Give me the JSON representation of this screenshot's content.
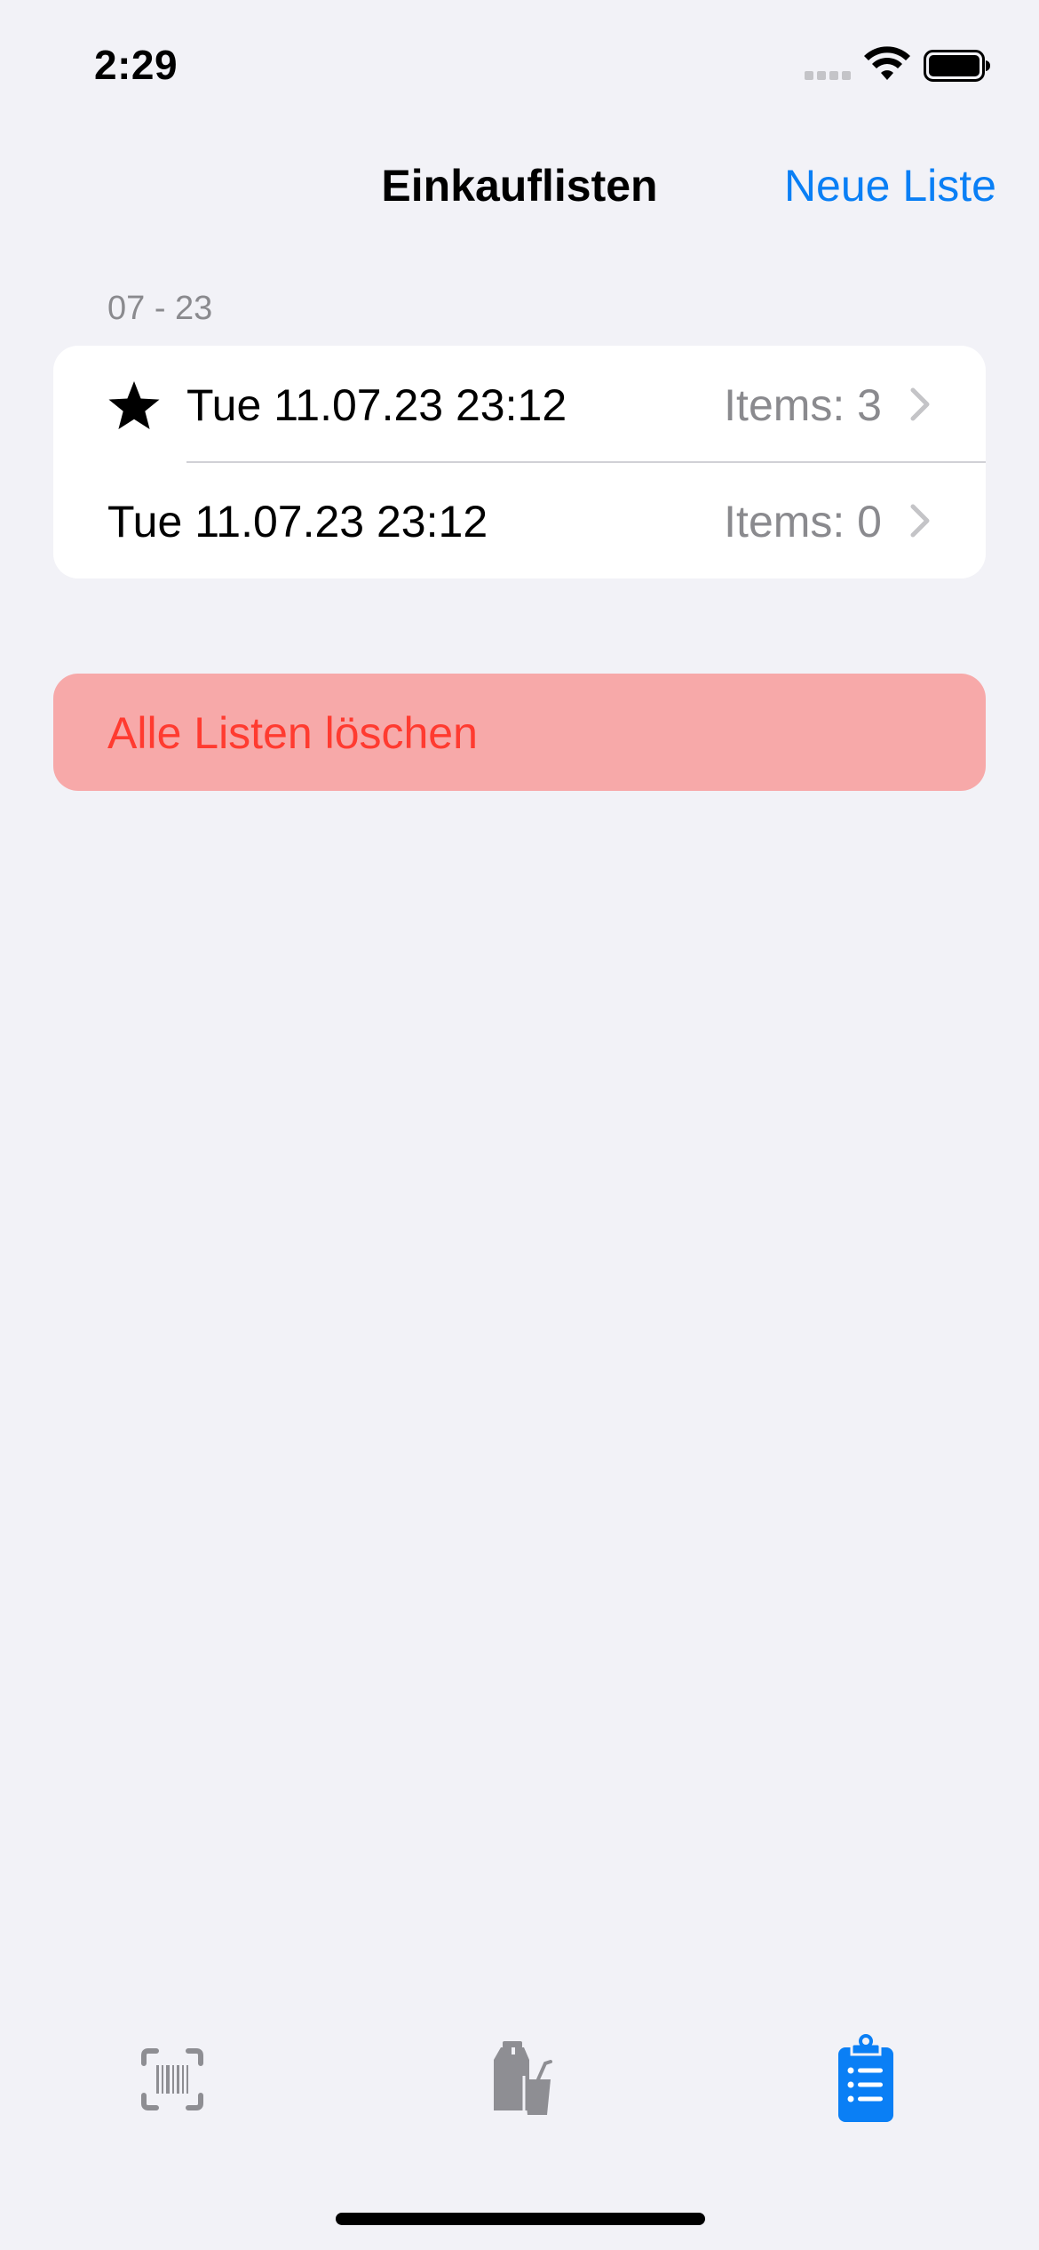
{
  "status_bar": {
    "time": "2:29"
  },
  "nav": {
    "title": "Einkauflisten",
    "action_label": "Neue Liste"
  },
  "section": {
    "header": "07 - 23",
    "rows": [
      {
        "title": "Tue 11.07.23 23:12",
        "count": "Items: 3",
        "starred": true
      },
      {
        "title": "Tue 11.07.23 23:12",
        "count": "Items: 0",
        "starred": false
      }
    ]
  },
  "delete_all": {
    "label": "Alle Listen löschen"
  },
  "tab_bar": {
    "tabs": [
      {
        "icon": "barcode-scan-icon",
        "selected": false
      },
      {
        "icon": "grocery-products-icon",
        "selected": false
      },
      {
        "icon": "clipboard-list-icon",
        "selected": true
      }
    ]
  },
  "colors": {
    "background": "#f2f2f7",
    "accent": "#0a7ff5",
    "destructive": "#ff3b30",
    "destructive_fill": "#f7a9a9",
    "secondary_text": "#8a8a8e",
    "tab_inactive": "#8e8e93"
  }
}
